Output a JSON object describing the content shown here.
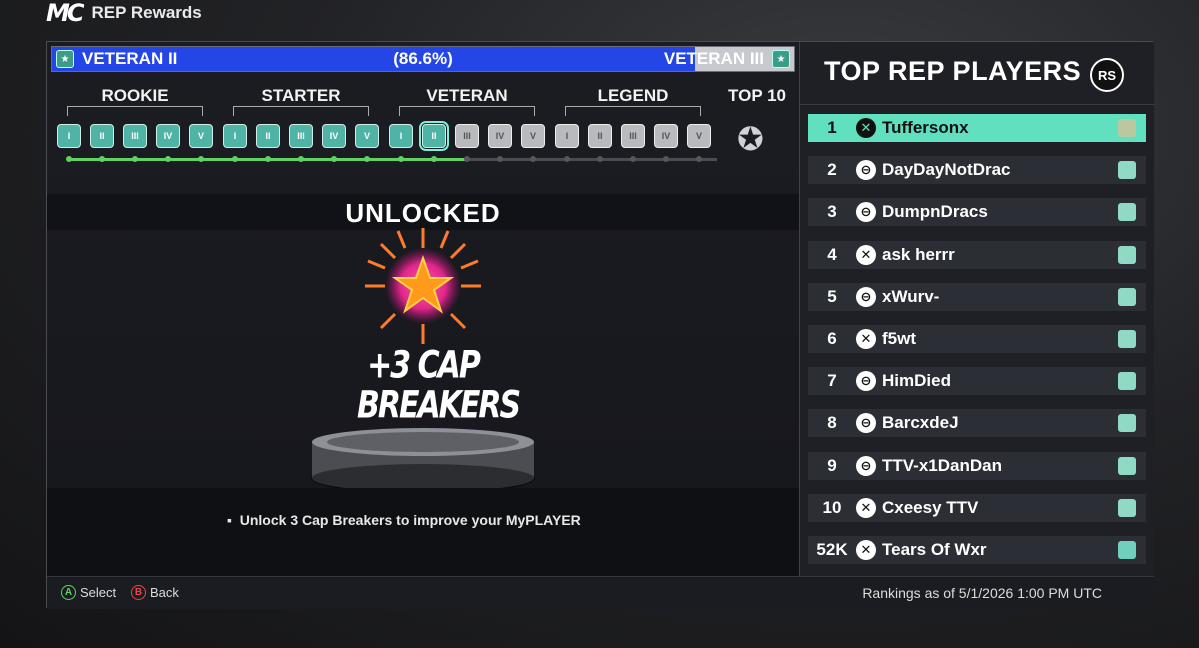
{
  "header": {
    "logo": "MC",
    "title": "REP Rewards"
  },
  "progress": {
    "current_tier": "VETERAN II",
    "percent_text": "(86.6%)",
    "next_tier": "VETERAN III",
    "fraction": 0.866
  },
  "tiers": [
    {
      "label": "ROOKIE",
      "ranks": [
        "I",
        "II",
        "III",
        "IV",
        "V"
      ]
    },
    {
      "label": "STARTER",
      "ranks": [
        "I",
        "II",
        "III",
        "IV",
        "V"
      ]
    },
    {
      "label": "VETERAN",
      "ranks": [
        "I",
        "II",
        "III",
        "IV",
        "V"
      ]
    },
    {
      "label": "LEGEND",
      "ranks": [
        "I",
        "II",
        "III",
        "IV",
        "V"
      ]
    }
  ],
  "top10_label": "TOP 10",
  "top10_icon": "star-top10-icon",
  "unlock": {
    "title": "UNLOCKED",
    "reward_line1": "+3 CAP",
    "reward_line2": "BREAKERS",
    "description": "Unlock 3 Cap Breakers to improve your MyPLAYER"
  },
  "leaderboard": {
    "title": "TOP REP PLAYERS",
    "rs_label": "RS",
    "rows": [
      {
        "rank": "1",
        "platform": "xbox",
        "name": "Tuffersonx"
      },
      {
        "rank": "2",
        "platform": "psn",
        "name": "DayDayNotDrac"
      },
      {
        "rank": "3",
        "platform": "psn",
        "name": "DumpnDracs"
      },
      {
        "rank": "4",
        "platform": "xbox",
        "name": "ask herrr"
      },
      {
        "rank": "5",
        "platform": "psn",
        "name": "xWurv-"
      },
      {
        "rank": "6",
        "platform": "xbox",
        "name": "f5wt"
      },
      {
        "rank": "7",
        "platform": "psn",
        "name": "HimDied"
      },
      {
        "rank": "8",
        "platform": "psn",
        "name": "BarcxdeJ"
      },
      {
        "rank": "9",
        "platform": "psn",
        "name": "TTV-x1DanDan"
      },
      {
        "rank": "10",
        "platform": "xbox",
        "name": "Cxeesy TTV"
      },
      {
        "rank": "52K",
        "platform": "xbox",
        "name": "Tears Of Wxr"
      }
    ]
  },
  "footer": {
    "select_btn": "A",
    "select_label": "Select",
    "back_btn": "B",
    "back_label": "Back",
    "rankings": "Rankings as of 5/1/2026 1:00 PM UTC"
  },
  "colors": {
    "progress_blue": "#2446e6",
    "accent_teal": "#61e0bf",
    "track_green": "#5fd35f"
  }
}
